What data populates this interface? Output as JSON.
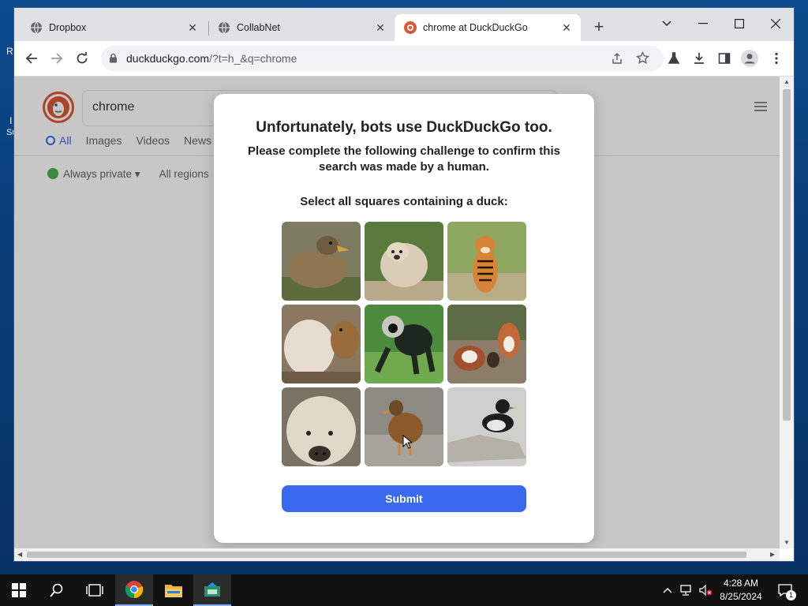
{
  "desktop": {
    "frag1": "R",
    "frag2": "I",
    "frag3": "Su"
  },
  "browser": {
    "tabs": [
      {
        "title": "Dropbox"
      },
      {
        "title": "CollabNet"
      },
      {
        "title": "chrome at DuckDuckGo"
      }
    ],
    "url": "duckduckgo.com",
    "url_rest": "/?t=h_&q=chrome"
  },
  "ddg": {
    "query": "chrome",
    "tabs": [
      "All",
      "Images",
      "Videos",
      "News"
    ],
    "filters": [
      "Always private",
      "All regions"
    ]
  },
  "challenge": {
    "title": "Unfortunately, bots use DuckDuckGo too.",
    "subtitle": "Please complete the following challenge to confirm this search was made by a human.",
    "prompt": "Select all squares containing a duck:",
    "images": [
      "duck",
      "bear",
      "tiger",
      "bear",
      "monkey",
      "dogs",
      "pig",
      "duck",
      "duck"
    ],
    "submit_label": "Submit"
  },
  "taskbar": {
    "time": "4:28 AM",
    "date": "8/25/2024",
    "notification_count": "1"
  },
  "colors": {
    "accent": "#3969ef",
    "ddg_orange": "#de5833"
  }
}
